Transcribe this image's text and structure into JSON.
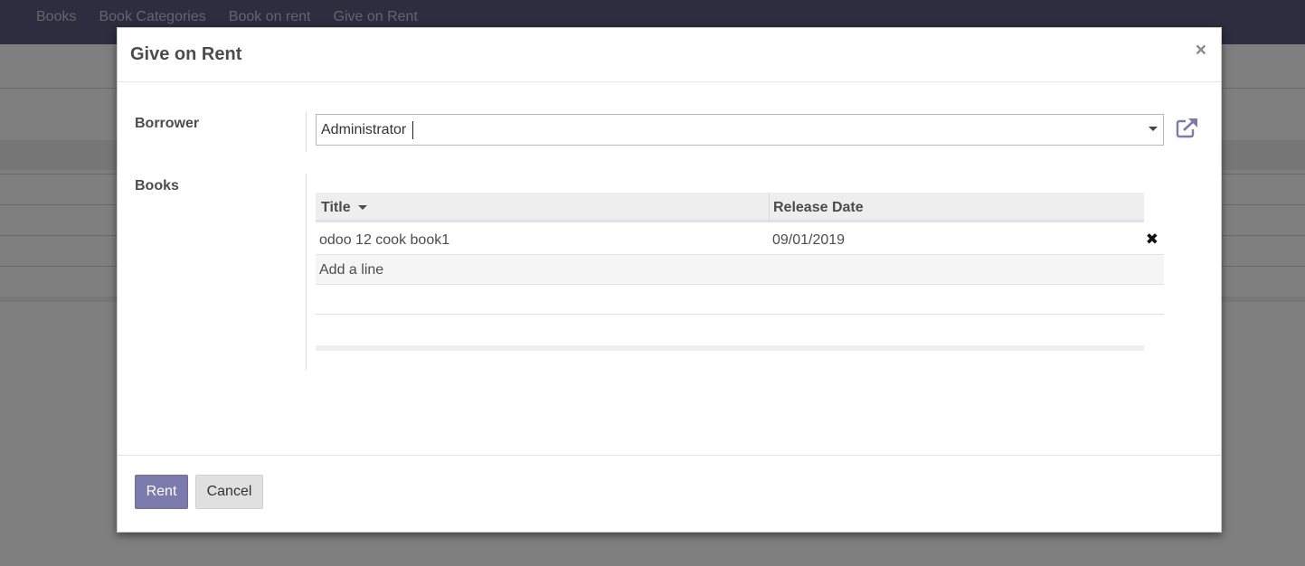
{
  "nav": {
    "items": [
      "Books",
      "Book Categories",
      "Book on rent",
      "Give on Rent"
    ]
  },
  "dialog": {
    "title": "Give on Rent",
    "close_symbol": "×"
  },
  "form": {
    "borrower": {
      "label": "Borrower",
      "value": "Administrator",
      "dropdown_icon": "caret-down-icon",
      "external_icon": "external-link-icon"
    },
    "books": {
      "label": "Books",
      "columns": [
        "Title",
        "Release Date"
      ],
      "sort_icon": "caret-down-icon",
      "rows": [
        {
          "title": "odoo 12 cook book1",
          "release_date": "09/01/2019"
        }
      ],
      "add_line_label": "Add a line",
      "delete_symbol": "✖"
    }
  },
  "footer": {
    "rent_label": "Rent",
    "cancel_label": "Cancel"
  },
  "colors": {
    "navbar": "#5b5a7e",
    "primary": "#7c7bad",
    "link": "#7c7bad"
  }
}
